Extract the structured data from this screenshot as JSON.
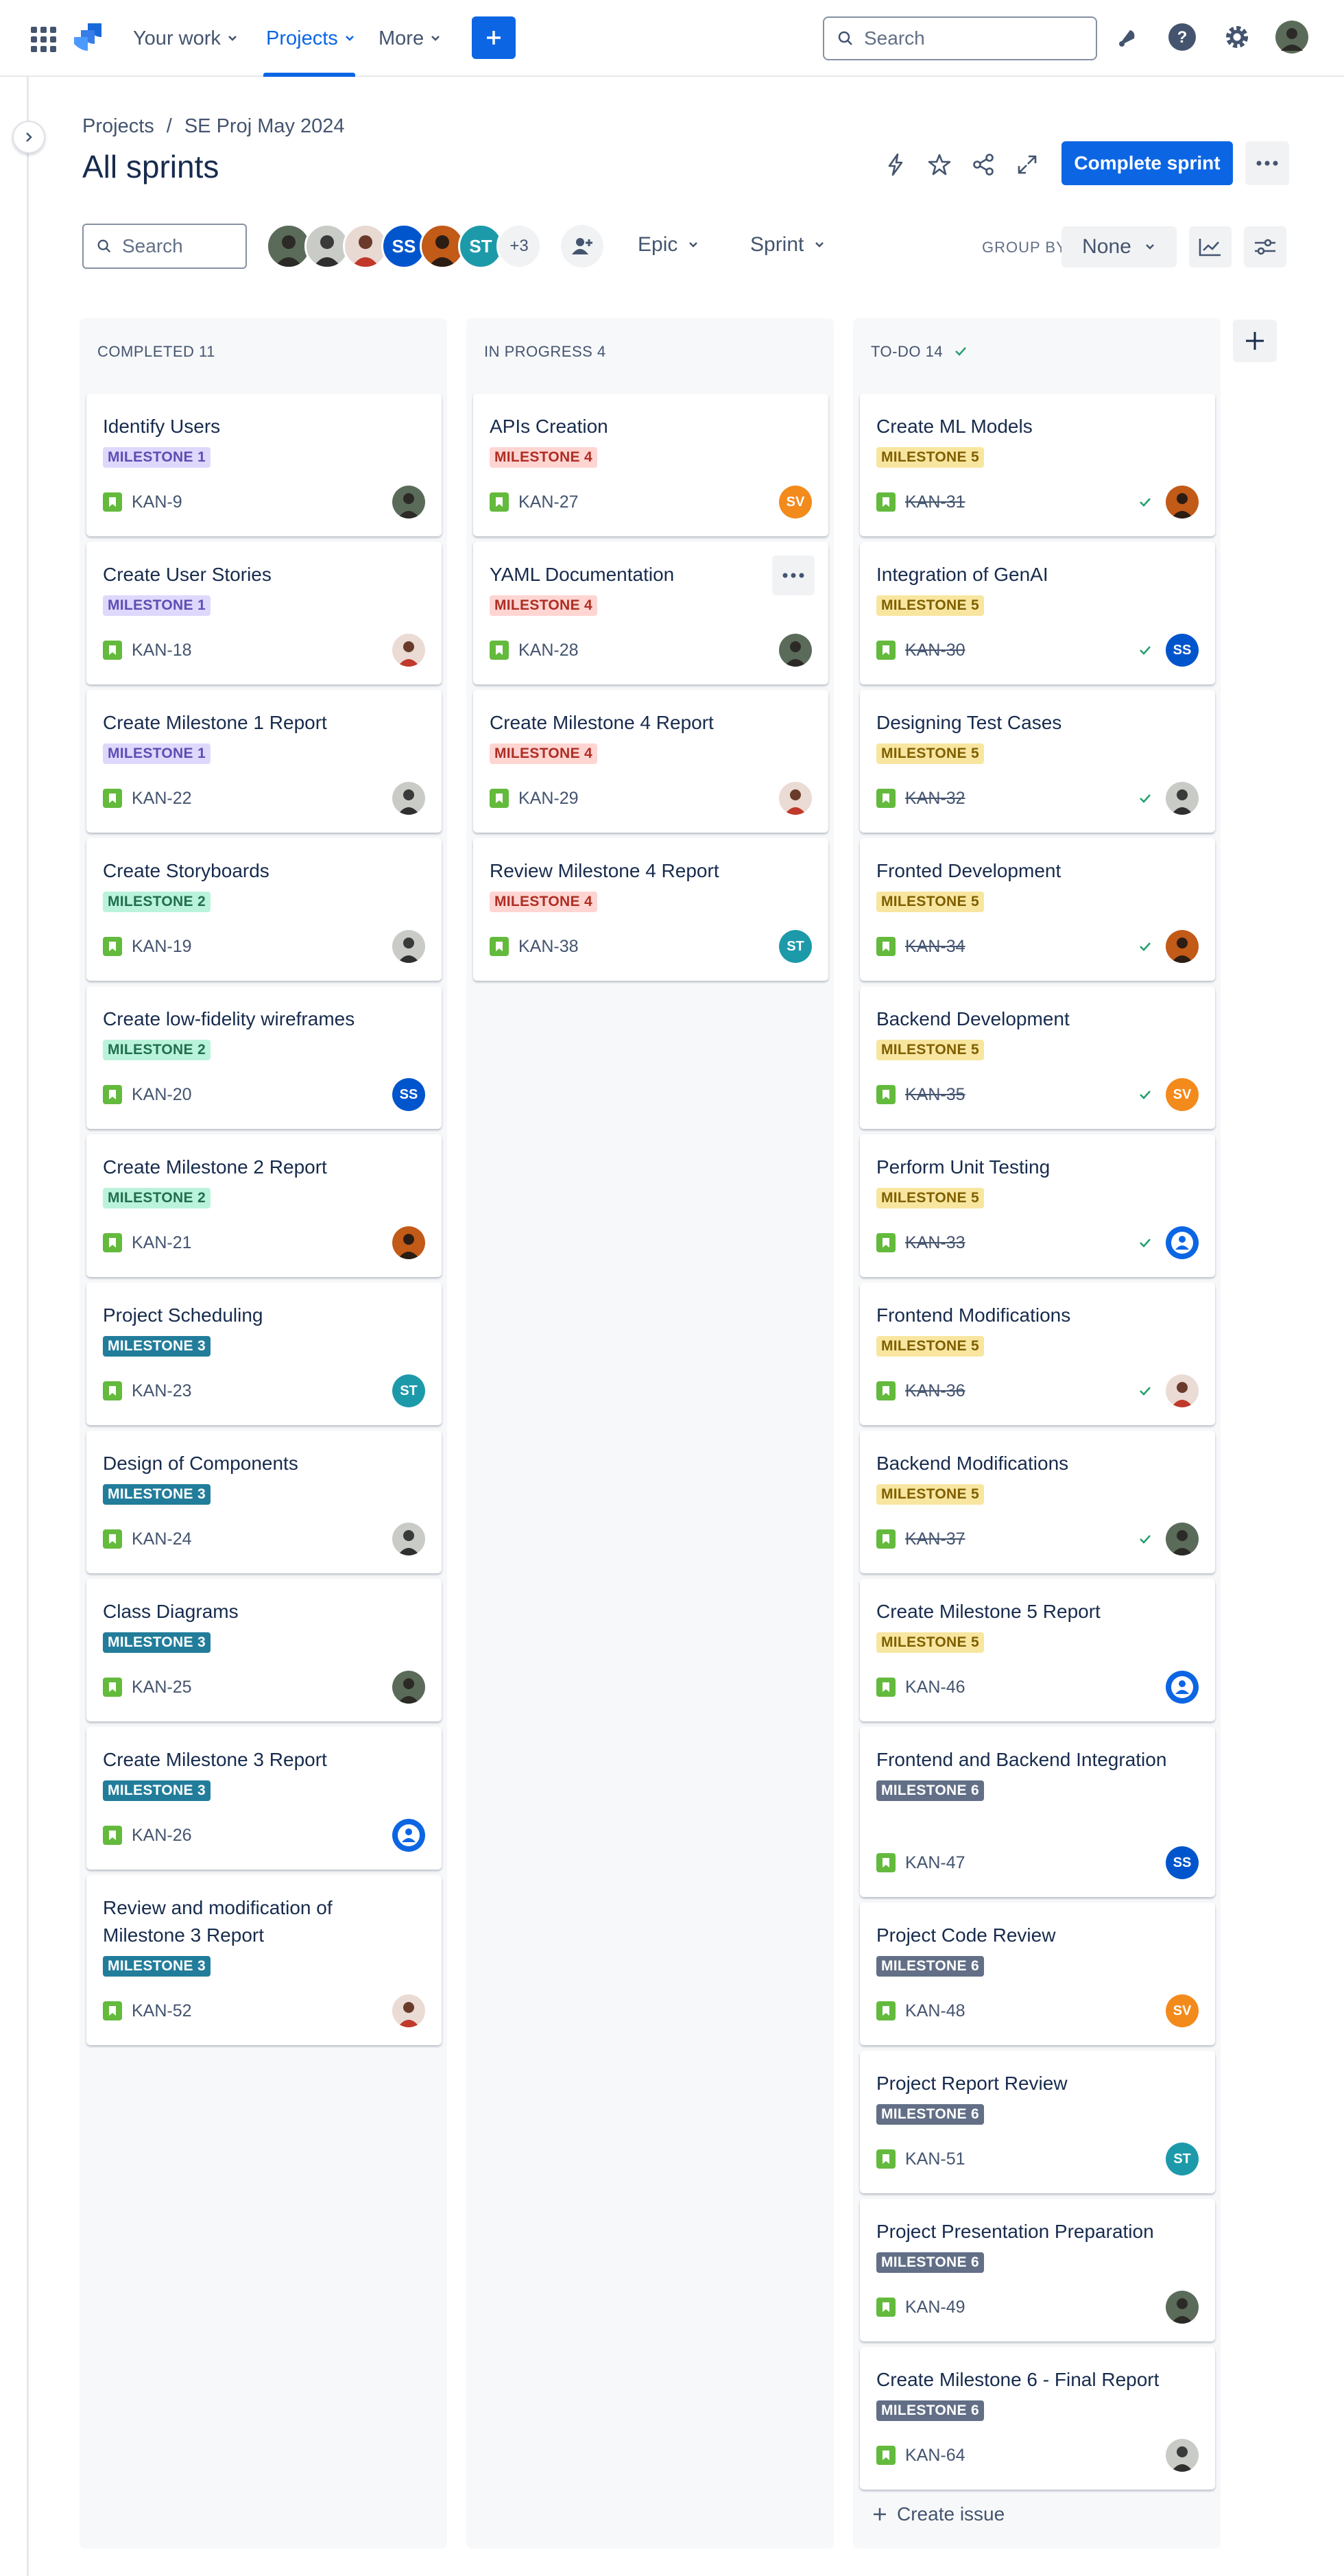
{
  "nav": {
    "your_work": "Your work",
    "projects": "Projects",
    "more": "More",
    "search_placeholder": "Search"
  },
  "header": {
    "breadcrumb_root": "Projects",
    "breadcrumb_sep": "/",
    "breadcrumb_project": "SE Proj May 2024",
    "title": "All sprints",
    "complete_sprint": "Complete sprint"
  },
  "filters": {
    "search_placeholder": "Search",
    "avatar_initials": [
      "SS",
      "ST"
    ],
    "more_people": "+3",
    "epic": "Epic",
    "sprint": "Sprint",
    "group_by_label": "GROUP BY",
    "group_by_value": "None"
  },
  "columns": {
    "completed": {
      "title": "COMPLETED 11",
      "cards": [
        {
          "title": "Identify Users",
          "label": "MILESTONE 1",
          "key": "KAN-9",
          "assignee": "photo-a"
        },
        {
          "title": "Create User Stories",
          "label": "MILESTONE 1",
          "key": "KAN-18",
          "assignee": "photo-b"
        },
        {
          "title": "Create Milestone 1 Report",
          "label": "MILESTONE 1",
          "key": "KAN-22",
          "assignee": "photo-c"
        },
        {
          "title": "Create Storyboards",
          "label": "MILESTONE 2",
          "key": "KAN-19",
          "assignee": "photo-c"
        },
        {
          "title": "Create low-fidelity wireframes",
          "label": "MILESTONE 2",
          "key": "KAN-20",
          "assignee": "SS"
        },
        {
          "title": "Create Milestone 2 Report",
          "label": "MILESTONE 2",
          "key": "KAN-21",
          "assignee": "photo-d"
        },
        {
          "title": "Project Scheduling",
          "label": "MILESTONE 3",
          "key": "KAN-23",
          "assignee": "ST"
        },
        {
          "title": "Design of Components",
          "label": "MILESTONE 3",
          "key": "KAN-24",
          "assignee": "photo-c"
        },
        {
          "title": "Class Diagrams",
          "label": "MILESTONE 3",
          "key": "KAN-25",
          "assignee": "photo-a"
        },
        {
          "title": "Create Milestone 3 Report",
          "label": "MILESTONE 3",
          "key": "KAN-26",
          "assignee": "default"
        },
        {
          "title": "Review and modification of Milestone 3 Report",
          "label": "MILESTONE 3",
          "key": "KAN-52",
          "assignee": "photo-b"
        }
      ]
    },
    "in_progress": {
      "title": "IN PROGRESS 4",
      "cards": [
        {
          "title": "APIs Creation",
          "label": "MILESTONE 4",
          "key": "KAN-27",
          "assignee": "SV"
        },
        {
          "title": "YAML Documentation",
          "label": "MILESTONE 4",
          "key": "KAN-28",
          "assignee": "photo-a"
        },
        {
          "title": "Create Milestone 4 Report",
          "label": "MILESTONE 4",
          "key": "KAN-29",
          "assignee": "photo-b"
        },
        {
          "title": "Review Milestone 4 Report",
          "label": "MILESTONE 4",
          "key": "KAN-38",
          "assignee": "ST"
        }
      ]
    },
    "todo": {
      "title": "TO-DO 14",
      "create_issue": "Create issue",
      "cards": [
        {
          "title": "Create ML Models",
          "label": "MILESTONE 5",
          "key": "KAN-31",
          "assignee": "photo-d",
          "done": true
        },
        {
          "title": "Integration of GenAI",
          "label": "MILESTONE 5",
          "key": "KAN-30",
          "assignee": "SS",
          "done": true
        },
        {
          "title": "Designing Test Cases",
          "label": "MILESTONE 5",
          "key": "KAN-32",
          "assignee": "photo-c",
          "done": true
        },
        {
          "title": "Fronted Development",
          "label": "MILESTONE 5",
          "key": "KAN-34",
          "assignee": "photo-d",
          "done": true
        },
        {
          "title": "Backend Development",
          "label": "MILESTONE 5",
          "key": "KAN-35",
          "assignee": "SV",
          "done": true
        },
        {
          "title": "Perform Unit Testing",
          "label": "MILESTONE 5",
          "key": "KAN-33",
          "assignee": "default",
          "done": true
        },
        {
          "title": "Frontend Modifications",
          "label": "MILESTONE 5",
          "key": "KAN-36",
          "assignee": "photo-b",
          "done": true
        },
        {
          "title": "Backend Modifications",
          "label": "MILESTONE 5",
          "key": "KAN-37",
          "assignee": "photo-a",
          "done": true
        },
        {
          "title": "Create Milestone 5 Report",
          "label": "MILESTONE 5",
          "key": "KAN-46",
          "assignee": "default",
          "done": false
        },
        {
          "title": "Frontend and Backend Integration",
          "label": "MILESTONE 6",
          "key": "KAN-47",
          "assignee": "SS",
          "done": false
        },
        {
          "title": "Project Code Review",
          "label": "MILESTONE 6",
          "key": "KAN-48",
          "assignee": "SV",
          "done": false
        },
        {
          "title": "Project Report Review",
          "label": "MILESTONE 6",
          "key": "KAN-51",
          "assignee": "ST",
          "done": false
        },
        {
          "title": "Project Presentation Preparation",
          "label": "MILESTONE 6",
          "key": "KAN-49",
          "assignee": "photo-a",
          "done": false
        },
        {
          "title": "Create Milestone 6 - Final Report",
          "label": "MILESTONE 6",
          "key": "KAN-64",
          "assignee": "photo-c",
          "done": false
        }
      ]
    }
  },
  "colors": {
    "brand_blue": "#0c66e4",
    "story_green": "#63ba3c",
    "avatar_SS": "#0055cc",
    "avatar_ST": "#1d9aaa",
    "avatar_SV": "#f38a1c"
  }
}
